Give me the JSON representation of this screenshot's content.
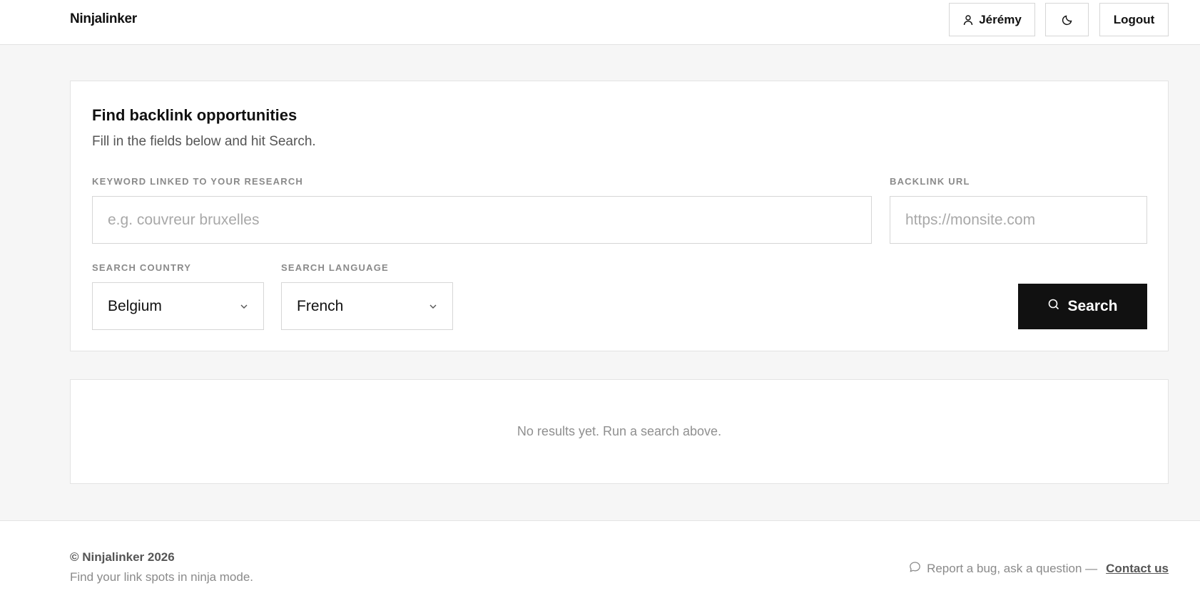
{
  "header": {
    "brand": "Ninjalinker",
    "user_label": "Jérémy",
    "logout_label": "Logout"
  },
  "search_card": {
    "title": "Find backlink opportunities",
    "subtitle": "Fill in the fields below and hit Search.",
    "keyword": {
      "label": "KEYWORD LINKED TO YOUR RESEARCH",
      "placeholder": "e.g. couvreur bruxelles",
      "value": ""
    },
    "backlink": {
      "label": "BACKLINK URL",
      "placeholder": "https://monsite.com",
      "value": ""
    },
    "country": {
      "label": "SEARCH COUNTRY",
      "selected": "Belgium"
    },
    "language": {
      "label": "SEARCH LANGUAGE",
      "selected": "French"
    },
    "search_label": "Search"
  },
  "results": {
    "empty_text": "No results yet. Run a search above."
  },
  "footer": {
    "copyright": "© Ninjalinker 2026",
    "tagline": "Find your link spots in ninja mode.",
    "report_text": "Report a bug, ask a question —",
    "contact_label": "Contact us"
  },
  "icons": {
    "user": "user-icon",
    "theme": "moon-icon",
    "chevron": "chevron-down-icon",
    "search": "search-icon",
    "chat": "chat-bubble-icon"
  },
  "colors": {
    "page_bg": "#f6f6f6",
    "card_bg": "#ffffff",
    "border": "#e3e3e3",
    "primary_button": "#111111",
    "muted_text": "#8a8a8a"
  }
}
